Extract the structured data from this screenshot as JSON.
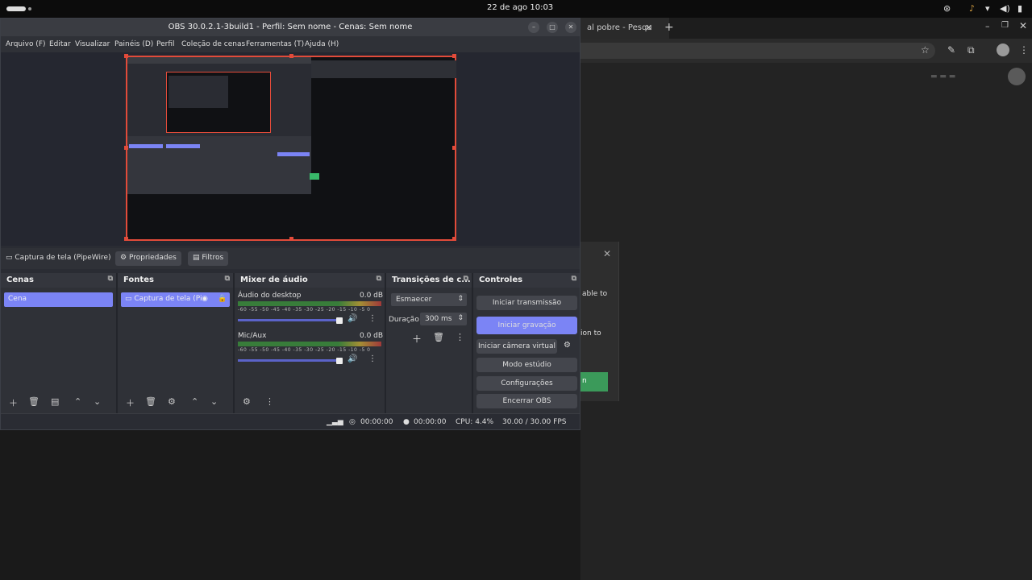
{
  "topbar": {
    "clock": "22 de ago  10:03",
    "tray_icons": [
      "accessibility-icon",
      "audio-icon",
      "wifi-icon",
      "volume-icon",
      "battery-icon"
    ]
  },
  "browser": {
    "tab_title": "al pobre - Pesqu",
    "dialog_line1": "able to",
    "dialog_line2": "ion to",
    "dialog_button": "n"
  },
  "obs": {
    "title": "OBS 30.0.2.1-3build1 - Perfil: Sem nome - Cenas: Sem nome",
    "menu": [
      "Arquivo (F)",
      "Editar",
      "Visualizar",
      "Painéis (D)",
      "Perfil",
      "Coleção de cenas",
      "Ferramentas (T)",
      "Ajuda (H)"
    ],
    "source_toolbar": {
      "source_name": "Captura de tela (PipeWire)",
      "properties": "Propriedades",
      "filters": "Filtros"
    },
    "docks": {
      "scenes": {
        "title": "Cenas",
        "items": [
          "Cena"
        ]
      },
      "sources": {
        "title": "Fontes",
        "items": [
          "Captura de tela (Pi"
        ]
      },
      "mixer": {
        "title": "Mixer de áudio",
        "channels": [
          {
            "name": "Áudio do desktop",
            "db": "0.0 dB"
          },
          {
            "name": "Mic/Aux",
            "db": "0.0 dB"
          }
        ],
        "scale": "-60 -55 -50 -45 -40 -35 -30 -25 -20 -15 -10 -5 0"
      },
      "transitions": {
        "title": "Transições de c...",
        "selected": "Esmaecer",
        "duration_label": "Duração",
        "duration_value": "300 ms"
      },
      "controls": {
        "title": "Controles",
        "buttons": [
          "Iniciar transmissão",
          "Iniciar gravação",
          "Iniciar câmera virtual",
          "Modo estúdio",
          "Configurações",
          "Encerrar OBS"
        ]
      }
    },
    "status": {
      "rec_time": "00:00:00",
      "stream_time": "00:00:00",
      "cpu": "CPU: 4.4%",
      "fps": "30.00 / 30.00 FPS"
    }
  }
}
